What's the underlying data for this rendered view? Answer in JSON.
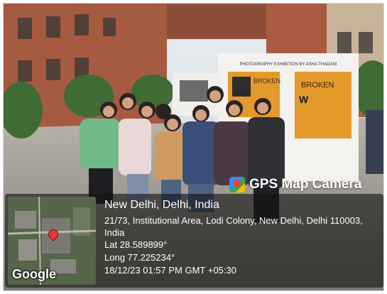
{
  "brand": {
    "label": "GPS Map Camera",
    "icon": "map-pin-camera-icon"
  },
  "photo": {
    "banner_text": "PHOTOGRAPHY EXHIBITION BY ASHA THADANI",
    "panel_left_title": "BROKEN",
    "panel_right_title": "BROKEN",
    "panel_right_letter": "W",
    "colors": {
      "panel_orange": "#e39a2b",
      "board_white": "#f4f2ee",
      "brick": "#a65a40"
    }
  },
  "overlay": {
    "title": "New Delhi, Delhi, India",
    "address": "21/73, Institutional Area, Lodi Colony, New Delhi, Delhi 110003, India",
    "lat": "Lat 28.589899°",
    "long": "Long 77.225234°",
    "timestamp": "18/12/23 01:57 PM GMT +05:30",
    "map_logo": "Google"
  }
}
